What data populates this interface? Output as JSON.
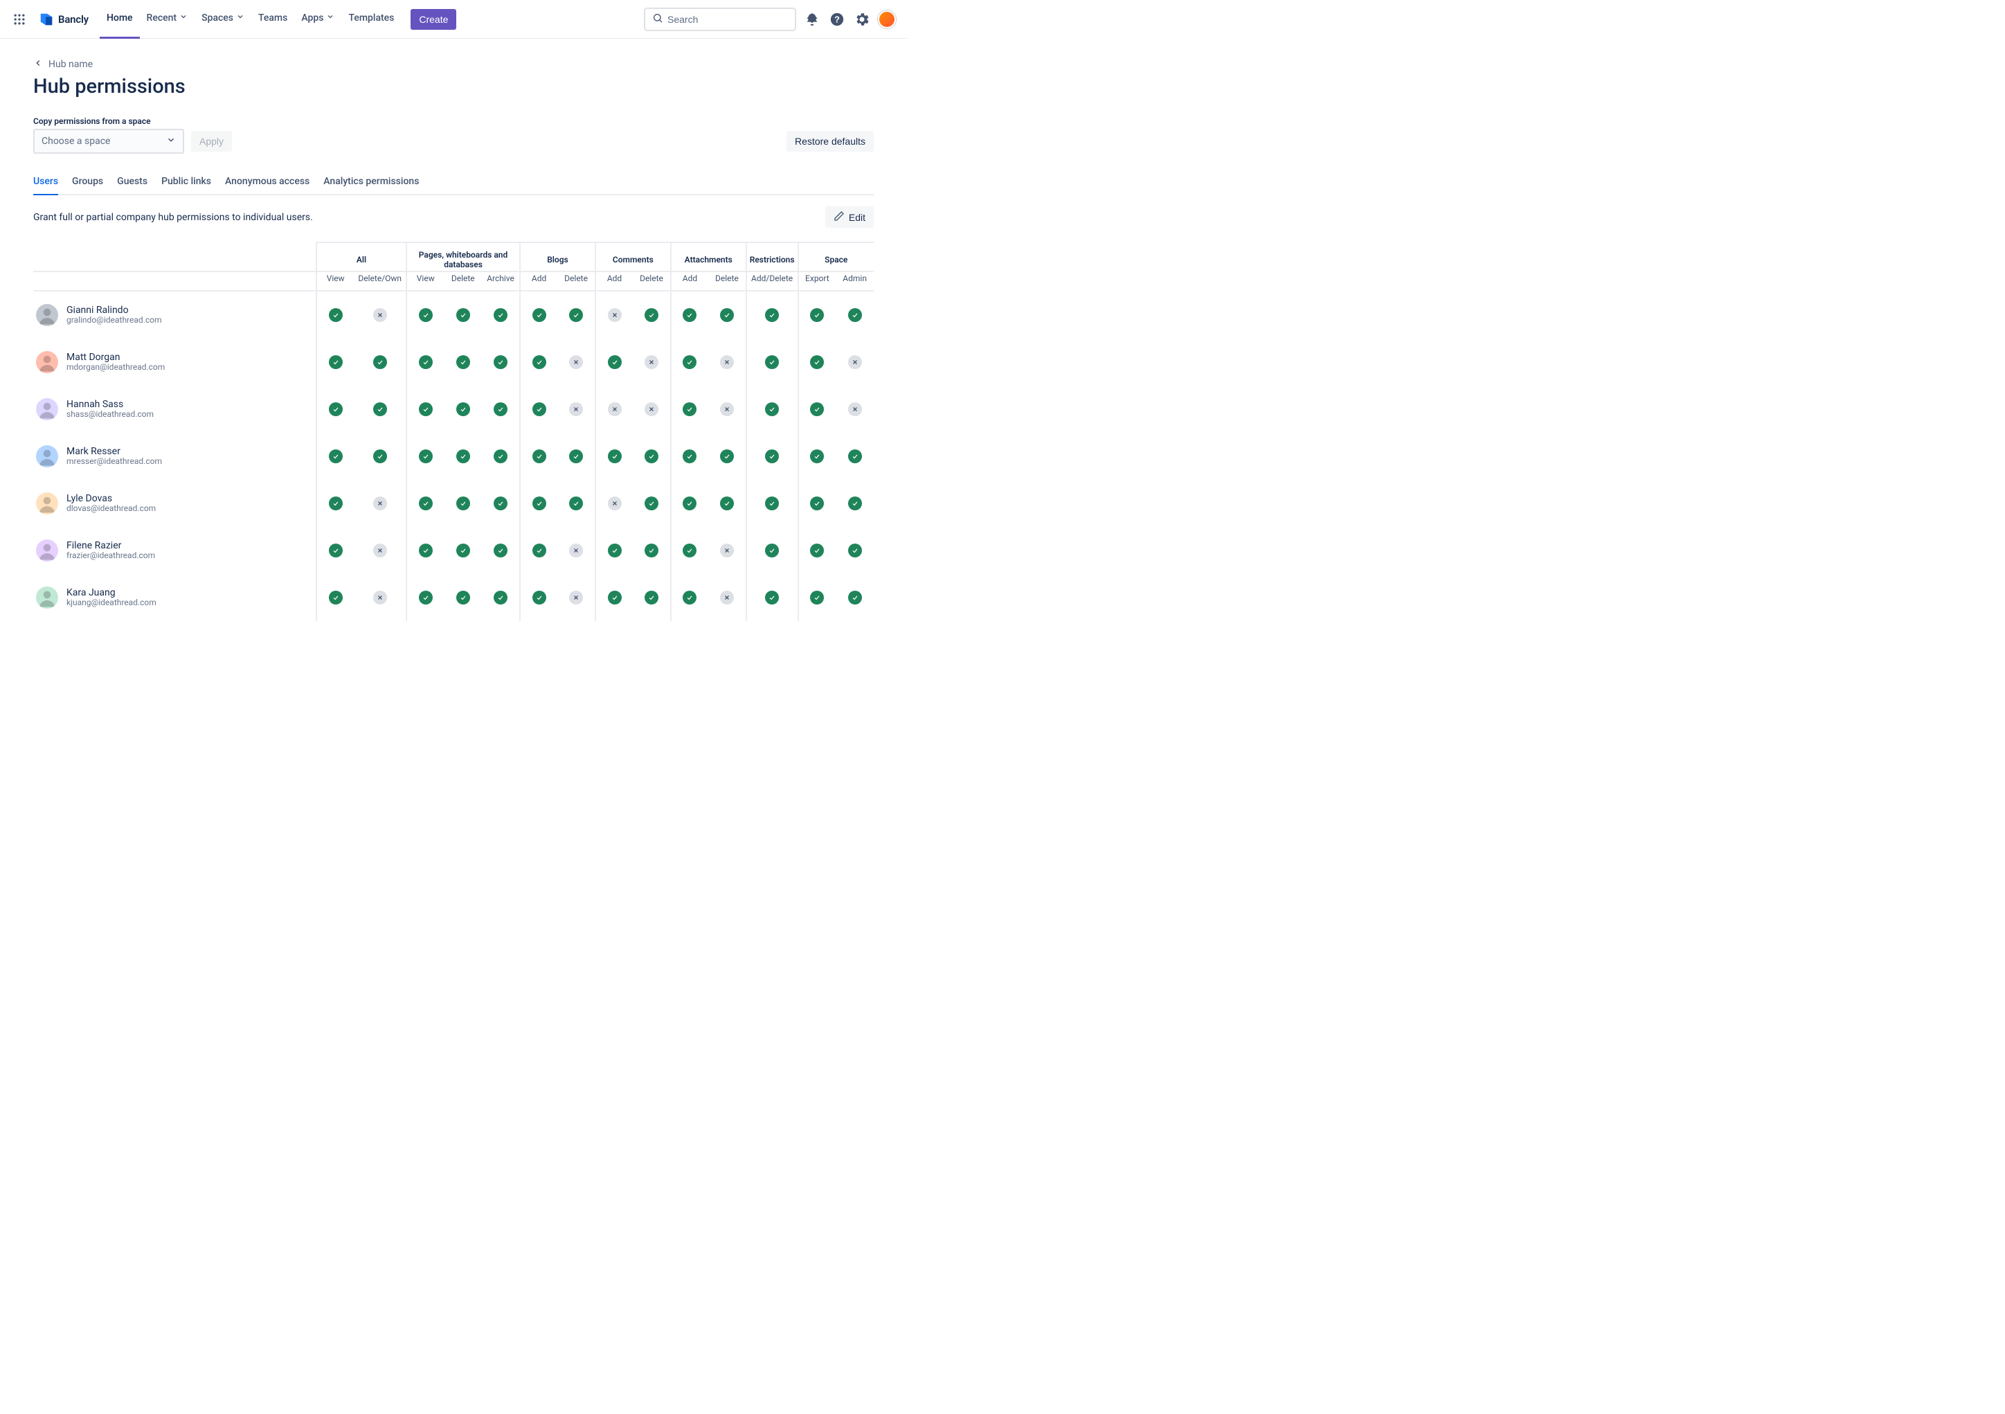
{
  "brand": {
    "name": "Bancly"
  },
  "nav": {
    "items": [
      {
        "label": "Home",
        "dropdown": false,
        "active": true
      },
      {
        "label": "Recent",
        "dropdown": true
      },
      {
        "label": "Spaces",
        "dropdown": true
      },
      {
        "label": "Teams",
        "dropdown": false
      },
      {
        "label": "Apps",
        "dropdown": true
      },
      {
        "label": "Templates",
        "dropdown": false
      }
    ],
    "create_label": "Create"
  },
  "search": {
    "placeholder": "Search"
  },
  "breadcrumb": {
    "back_label": "Hub name"
  },
  "page": {
    "title": "Hub permissions",
    "copy_label": "Copy permissions from a space",
    "space_placeholder": "Choose a space",
    "apply_label": "Apply",
    "restore_label": "Restore defaults"
  },
  "tabs": [
    {
      "label": "Users",
      "active": true
    },
    {
      "label": "Groups"
    },
    {
      "label": "Guests"
    },
    {
      "label": "Public links"
    },
    {
      "label": "Anonymous access"
    },
    {
      "label": "Analytics permissions"
    }
  ],
  "helper": {
    "text": "Grant full or partial company hub permissions to individual users.",
    "edit_label": "Edit"
  },
  "columns": {
    "groups": [
      {
        "label": "All",
        "subs": [
          "View",
          "Delete/Own"
        ]
      },
      {
        "label": "Pages, whiteboards and databases",
        "subs": [
          "View",
          "Delete",
          "Archive"
        ]
      },
      {
        "label": "Blogs",
        "subs": [
          "Add",
          "Delete"
        ]
      },
      {
        "label": "Comments",
        "subs": [
          "Add",
          "Delete"
        ]
      },
      {
        "label": "Attachments",
        "subs": [
          "Add",
          "Delete"
        ]
      },
      {
        "label": "Restrictions",
        "subs": [
          "Add/Delete"
        ]
      },
      {
        "label": "Space",
        "subs": [
          "Export",
          "Admin"
        ]
      }
    ]
  },
  "users": [
    {
      "name": "Gianni Ralindo",
      "email": "gralindo@ideathread.com",
      "avatar_bg": "#C1C7D0",
      "perms": [
        true,
        false,
        true,
        true,
        true,
        true,
        true,
        false,
        true,
        true,
        true,
        true,
        true,
        true
      ]
    },
    {
      "name": "Matt Dorgan",
      "email": "mdorgan@ideathread.com",
      "avatar_bg": "#FFBDAD",
      "perms": [
        true,
        true,
        true,
        true,
        true,
        true,
        false,
        true,
        false,
        true,
        false,
        true,
        true,
        false
      ]
    },
    {
      "name": "Hannah Sass",
      "email": "shass@ideathread.com",
      "avatar_bg": "#DDD6FE",
      "perms": [
        true,
        true,
        true,
        true,
        true,
        true,
        false,
        false,
        false,
        true,
        false,
        true,
        true,
        false
      ]
    },
    {
      "name": "Mark Resser",
      "email": "mresser@ideathread.com",
      "avatar_bg": "#B3D4FF",
      "perms": [
        true,
        true,
        true,
        true,
        true,
        true,
        true,
        true,
        true,
        true,
        true,
        true,
        true,
        true
      ]
    },
    {
      "name": "Lyle Dovas",
      "email": "dlovas@ideathread.com",
      "avatar_bg": "#FFE2BD",
      "perms": [
        true,
        false,
        true,
        true,
        true,
        true,
        true,
        false,
        true,
        true,
        true,
        true,
        true,
        true
      ]
    },
    {
      "name": "Filene Razier",
      "email": "frazier@ideathread.com",
      "avatar_bg": "#E6D0FF",
      "perms": [
        true,
        false,
        true,
        true,
        true,
        true,
        false,
        true,
        true,
        true,
        false,
        true,
        true,
        true
      ]
    },
    {
      "name": "Kara Juang",
      "email": "kjuang@ideathread.com",
      "avatar_bg": "#C0E8D5",
      "perms": [
        true,
        false,
        true,
        true,
        true,
        true,
        false,
        true,
        true,
        true,
        false,
        true,
        true,
        true
      ]
    }
  ]
}
